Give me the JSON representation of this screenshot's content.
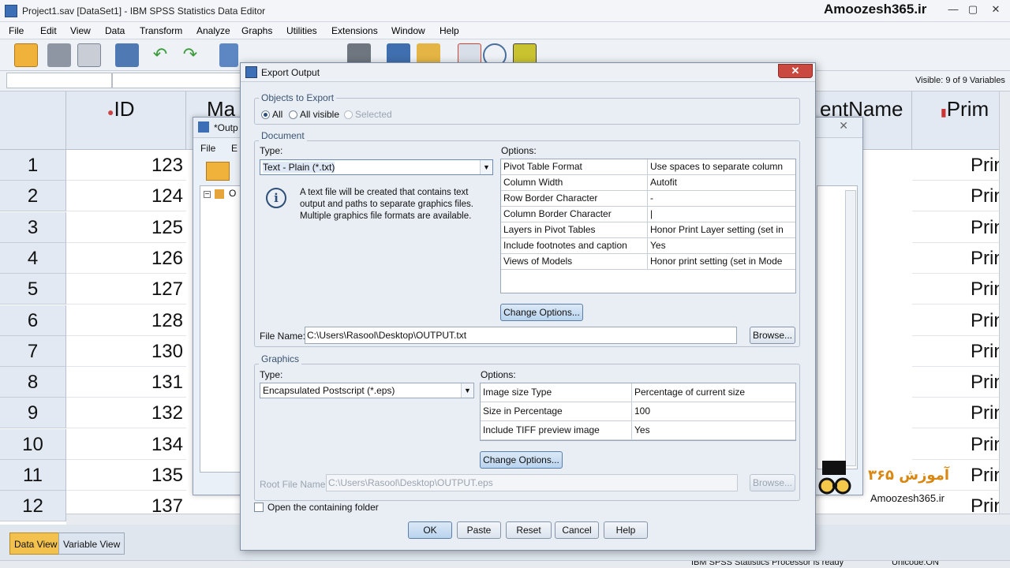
{
  "window": {
    "title": "Project1.sav [DataSet1] - IBM SPSS Statistics Data Editor",
    "watermark": "Amoozesh365.ir",
    "minimize": "—",
    "restore": "▢",
    "close": "✕"
  },
  "menu": [
    "File",
    "Edit",
    "View",
    "Data",
    "Transform",
    "Analyze",
    "Graphs",
    "Utilities",
    "Extensions",
    "Window",
    "Help"
  ],
  "visible_vars": "Visible: 9 of 9 Variables",
  "columns": {
    "id": "ID",
    "ma": "Ma",
    "name": "entName",
    "prim": "Prim"
  },
  "rows": [
    {
      "n": "1",
      "id": "123",
      "prim": "Prin"
    },
    {
      "n": "2",
      "id": "124",
      "prim": "Prin"
    },
    {
      "n": "3",
      "id": "125",
      "prim": "Prin"
    },
    {
      "n": "4",
      "id": "126",
      "prim": "Prin"
    },
    {
      "n": "5",
      "id": "127",
      "prim": "Prin"
    },
    {
      "n": "6",
      "id": "128",
      "prim": "Prin"
    },
    {
      "n": "7",
      "id": "130",
      "prim": "Prin"
    },
    {
      "n": "8",
      "id": "131",
      "prim": "Prin"
    },
    {
      "n": "9",
      "id": "132",
      "prim": "Prin"
    },
    {
      "n": "10",
      "id": "134",
      "prim": "Prin"
    },
    {
      "n": "11",
      "id": "135",
      "prim": "Prin"
    },
    {
      "n": "12",
      "id": "137",
      "prim": "Prin"
    }
  ],
  "tabs": {
    "data_view": "Data View",
    "variable_view": "Variable View"
  },
  "status": {
    "processor": "IBM SPSS Statistics Processor is ready",
    "unicode": "Unicode:ON"
  },
  "output_window": {
    "title": "*Outp",
    "menu_file": "File",
    "menu_edit": "E",
    "tree_item": "O"
  },
  "dialog": {
    "title": "Export Output",
    "objects": {
      "label": "Objects to Export",
      "all": "All",
      "all_visible": "All visible",
      "selected": "Selected"
    },
    "document": {
      "label": "Document",
      "type_label": "Type:",
      "type_value": "Text - Plain (*.txt)",
      "options_label": "Options:",
      "info": "A text file will be created that contains text output and paths to separate graphics files. Multiple graphics file formats are available.",
      "options": [
        {
          "k": "Pivot Table Format",
          "v": "Use spaces to separate columns"
        },
        {
          "k": "Column Width",
          "v": "Autofit"
        },
        {
          "k": "Row Border Character",
          "v": "-"
        },
        {
          "k": "Column Border Character",
          "v": "|"
        },
        {
          "k": "Layers in Pivot Tables",
          "v": "Honor Print Layer setting (set in T..."
        },
        {
          "k": "Include footnotes and caption",
          "v": "Yes"
        },
        {
          "k": "Views of Models",
          "v": "Honor print setting (set in Model V..."
        }
      ],
      "change_options": "Change Options...",
      "file_name_label": "File Name:",
      "file_name": "C:\\Users\\Rasool\\Desktop\\OUTPUT.txt",
      "browse": "Browse..."
    },
    "graphics": {
      "label": "Graphics",
      "type_label": "Type:",
      "type_value": "Encapsulated Postscript (*.eps)",
      "options_label": "Options:",
      "options": [
        {
          "k": "Image size Type",
          "v": "Percentage of current size"
        },
        {
          "k": "Size in Percentage",
          "v": "100"
        },
        {
          "k": "Include TIFF preview image",
          "v": "Yes"
        }
      ],
      "change_options": "Change Options...",
      "root_label": "Root File Name:",
      "root_value": "C:\\Users\\Rasool\\Desktop\\OUTPUT.eps",
      "browse": "Browse..."
    },
    "open_folder": "Open the containing folder",
    "buttons": {
      "ok": "OK",
      "paste": "Paste",
      "reset": "Reset",
      "cancel": "Cancel",
      "help": "Help"
    }
  },
  "logo": {
    "text": "آموزش ۳۶۵",
    "site": "Amoozesh365.ir"
  }
}
